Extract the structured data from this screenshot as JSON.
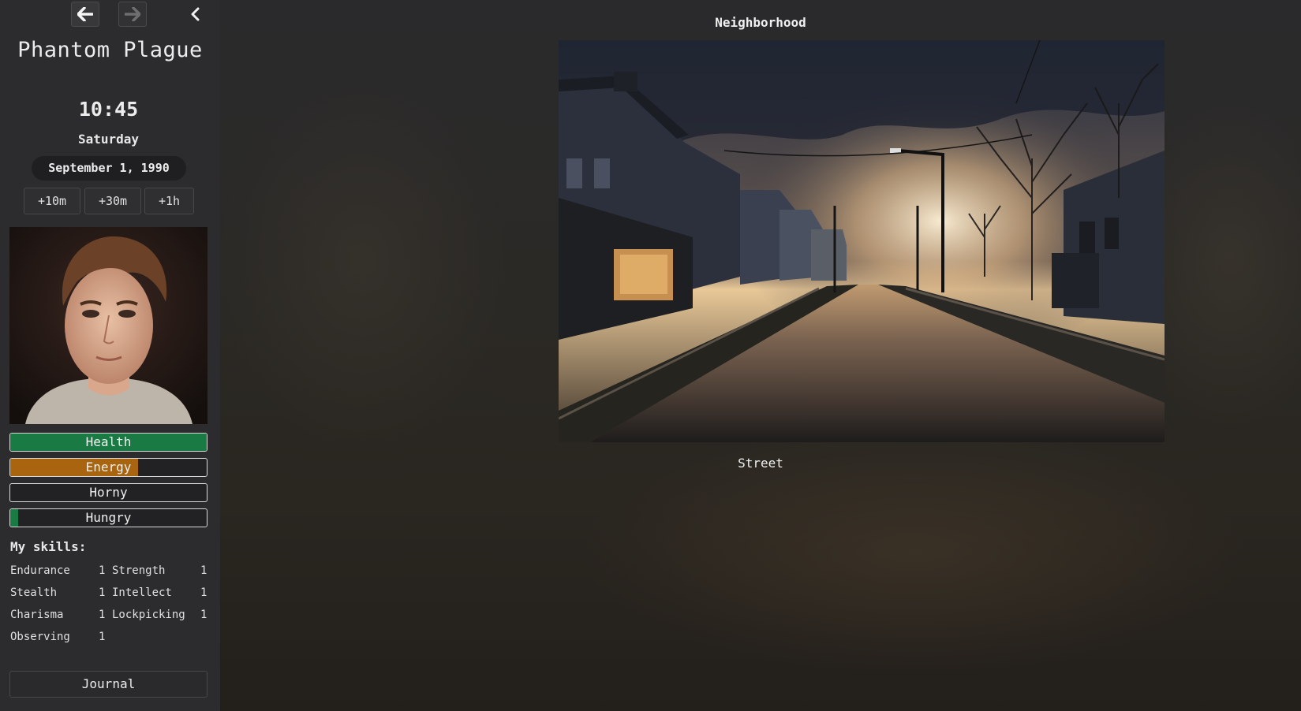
{
  "sidebar": {
    "title": "Phantom Plague",
    "time": "10:45",
    "day": "Saturday",
    "date": "September 1, 1990",
    "time_buttons": [
      "+10m",
      "+30m",
      "+1h"
    ],
    "stats": [
      {
        "label": "Health",
        "level": 1.0,
        "color": "#1a7a44"
      },
      {
        "label": "Energy",
        "level": 0.65,
        "color": "#a8640f"
      },
      {
        "label": "Horny",
        "level": 0.0,
        "color": "#1a7a44"
      },
      {
        "label": "Hungry",
        "level": 0.04,
        "color": "#1a7a44"
      }
    ],
    "skills_title": "My skills:",
    "skills": [
      {
        "name": "Endurance",
        "value": "1"
      },
      {
        "name": "Strength",
        "value": "1"
      },
      {
        "name": "Stealth",
        "value": "1"
      },
      {
        "name": "Intellect",
        "value": "1"
      },
      {
        "name": "Charisma",
        "value": "1"
      },
      {
        "name": "Lockpicking",
        "value": "1"
      },
      {
        "name": "Observing",
        "value": "1"
      }
    ],
    "journal": "Journal"
  },
  "main": {
    "location": "Neighborhood",
    "scene_label": "Street"
  }
}
